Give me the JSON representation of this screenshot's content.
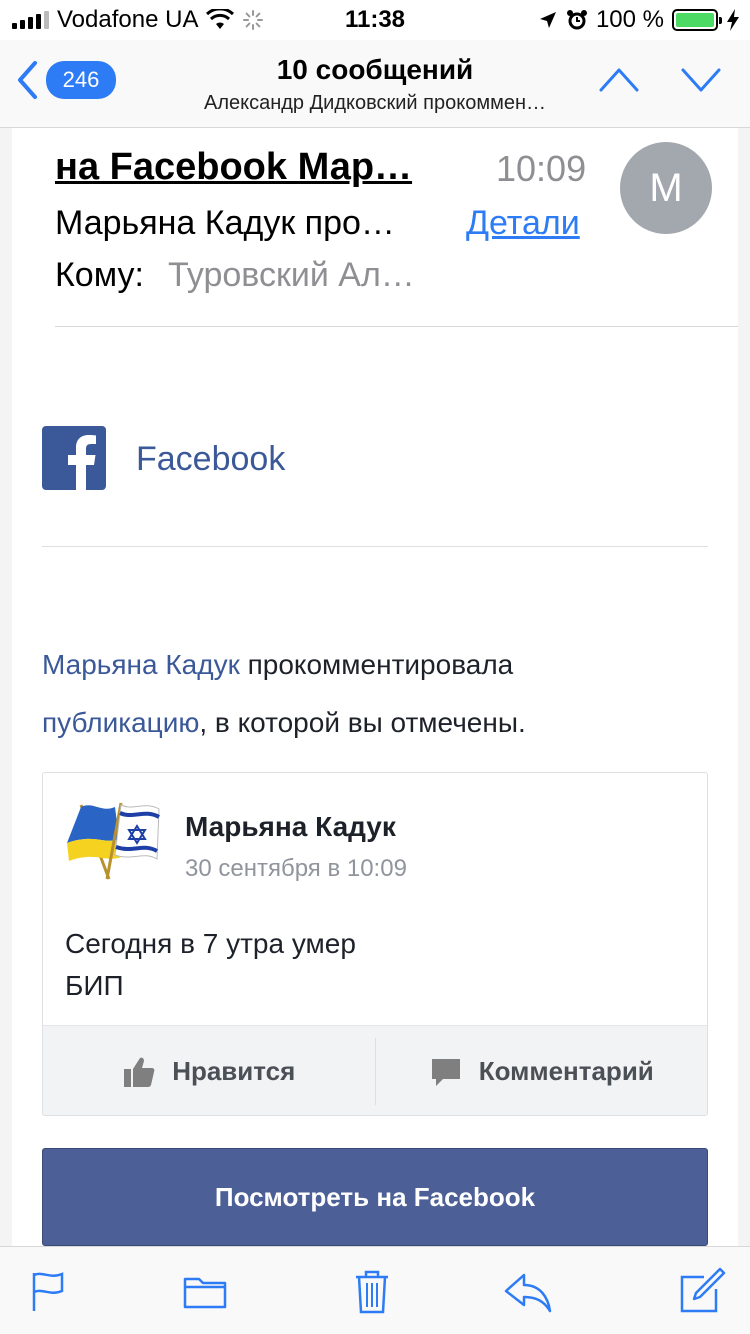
{
  "status_bar": {
    "carrier": "Vodafone UA",
    "time": "11:38",
    "battery_percent": "100 %",
    "battery_level": 1.0
  },
  "nav": {
    "back_badge": "246",
    "title": "10 сообщений",
    "subtitle": "Александр Дидковский прокоммен…"
  },
  "email": {
    "subject": "на Facebook Мар…",
    "time": "10:09",
    "avatar_initial": "M",
    "from": "Марьяна Кадук про…",
    "details_link": "Детали",
    "to_label": "Кому:",
    "to_value": "Туровский Ал…"
  },
  "fb": {
    "logo_text": "Facebook",
    "notif_author": "Марьяна Кадук",
    "notif_middle": " прокомментировала ",
    "notif_link": "публикацию",
    "notif_end": ", в которой вы отмечены.",
    "post": {
      "author": "Марьяна Кадук",
      "date": "30 сентября в 10:09",
      "text_line1": "Сегодня в 7 утра умер",
      "text_line2": "БИП",
      "like_label": "Нравится",
      "comment_label": "Комментарий"
    },
    "view_button": "Посмотреть на Facebook"
  },
  "toolbar": {
    "icons": [
      "flag-icon",
      "folder-icon",
      "trash-icon",
      "reply-icon",
      "compose-icon"
    ]
  },
  "colors": {
    "ios_blue": "#2d7cf6",
    "facebook_blue": "#3b5998",
    "button_blue": "#4d5f97",
    "battery_green": "#4cd964"
  }
}
